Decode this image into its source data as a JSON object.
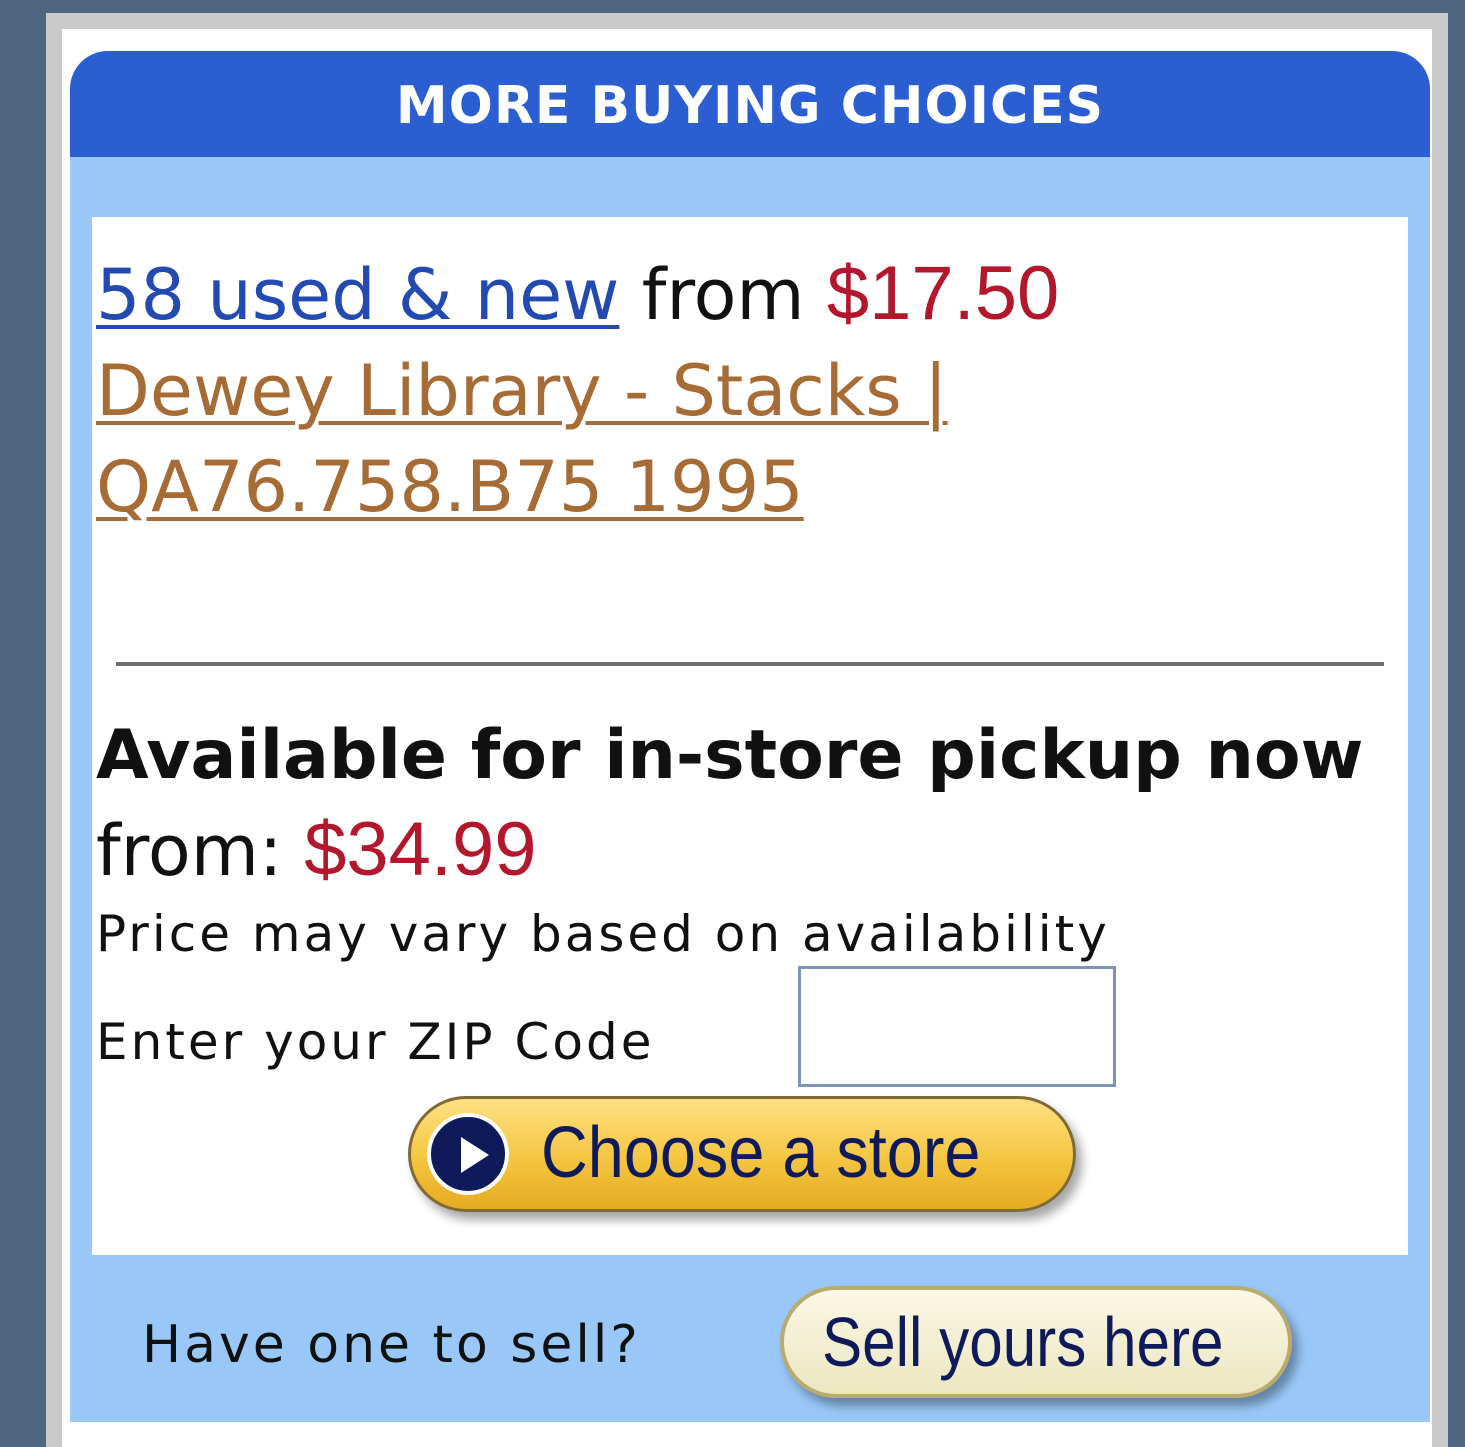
{
  "panel": {
    "title": "MORE BUYING CHOICES",
    "offers": {
      "used_new_link": "58 used & new",
      "from_text": "from",
      "price": "$17.50"
    },
    "library_link": "Dewey Library - Stacks | QA76.758.B75 1995",
    "pickup": {
      "heading": "Available for in-store pickup now",
      "from_text": "from:",
      "price": "$34.99",
      "note": "Price may vary based on availability",
      "zip_label": "Enter your ZIP Code",
      "zip_value": "",
      "choose_button": "Choose a store"
    },
    "sell": {
      "prompt": "Have one to sell?",
      "button": "Sell yours here"
    }
  },
  "colors": {
    "background": "#4f6680",
    "header": "#2b5fd1",
    "panel_light_blue": "#99c8f8",
    "price_red": "#b3172c",
    "link_blue": "#224ab0",
    "library_link": "#a76b36",
    "choose_button_gold": "#f4c540",
    "sell_button_cream": "#ece6c0"
  },
  "icons": {
    "choose_button_icon": "play-circle-icon"
  }
}
